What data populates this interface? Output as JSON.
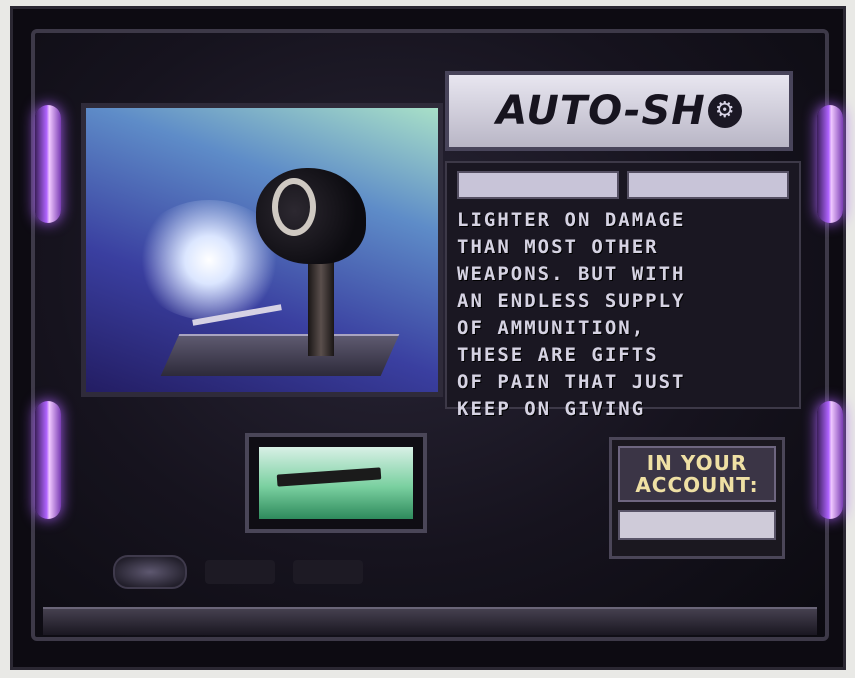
{
  "title": {
    "text": "AUTO-SH",
    "suffix_icon": "wrench-icon"
  },
  "info": {
    "header_left": "",
    "header_right": "",
    "description_lines": [
      "LIGHTER ON DAMAGE",
      "THAN MOST OTHER",
      "WEAPONS. BUT WITH",
      "AN ENDLESS SUPPLY",
      "OF AMMUNITION,",
      "THESE ARE GIFTS",
      "OF PAIN THAT JUST",
      "KEEP ON GIVING"
    ]
  },
  "account": {
    "label": "IN YOUR ACCOUNT:",
    "value": ""
  },
  "bottom": {
    "text": ""
  },
  "colors": {
    "pillar_glow": "#b064ff",
    "panel_text": "#d6d3e3",
    "account_label": "#efe0a4"
  }
}
